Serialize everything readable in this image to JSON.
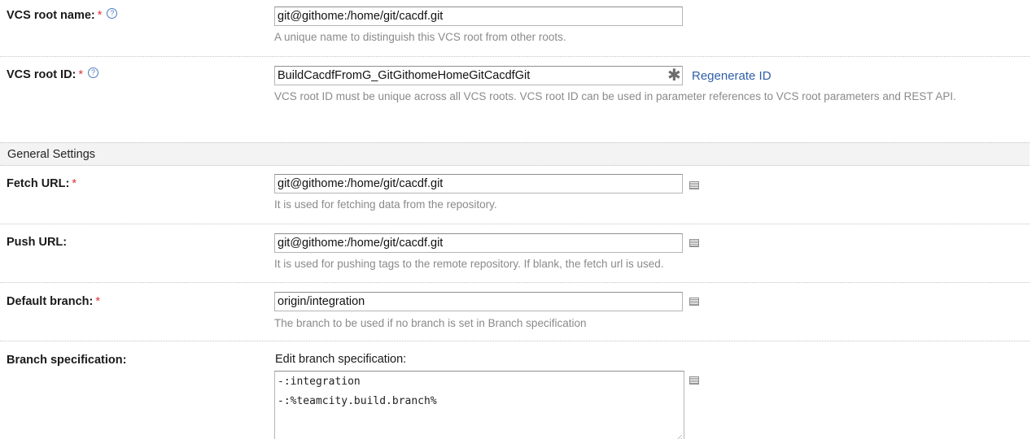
{
  "fields": {
    "vcs_root_name": {
      "label": "VCS root name:",
      "required": "*",
      "help": "?",
      "value": "git@githome:/home/git/cacdf.git",
      "note": "A unique name to distinguish this VCS root from other roots."
    },
    "vcs_root_id": {
      "label": "VCS root ID:",
      "required": "*",
      "help": "?",
      "value": "BuildCacdfFromG_GitGithomeHomeGitCacdfGit",
      "regenerate_label": "Regenerate ID",
      "note": "VCS root ID must be unique across all VCS roots. VCS root ID can be used in parameter references to VCS root parameters and REST API."
    }
  },
  "general_settings": {
    "title": "General Settings",
    "fetch_url": {
      "label": "Fetch URL:",
      "required": "*",
      "value": "git@githome:/home/git/cacdf.git",
      "note": "It is used for fetching data from the repository."
    },
    "push_url": {
      "label": "Push URL:",
      "value": "git@githome:/home/git/cacdf.git",
      "note": "It is used for pushing tags to the remote repository. If blank, the fetch url is used."
    },
    "default_branch": {
      "label": "Default branch:",
      "required": "*",
      "value": "origin/integration",
      "note": "The branch to be used if no branch is set in Branch specification"
    },
    "branch_specification": {
      "label": "Branch specification:",
      "edit_label": "Edit branch specification:",
      "lines": [
        "-:integration",
        "-:%teamcity.build.branch%"
      ]
    }
  }
}
